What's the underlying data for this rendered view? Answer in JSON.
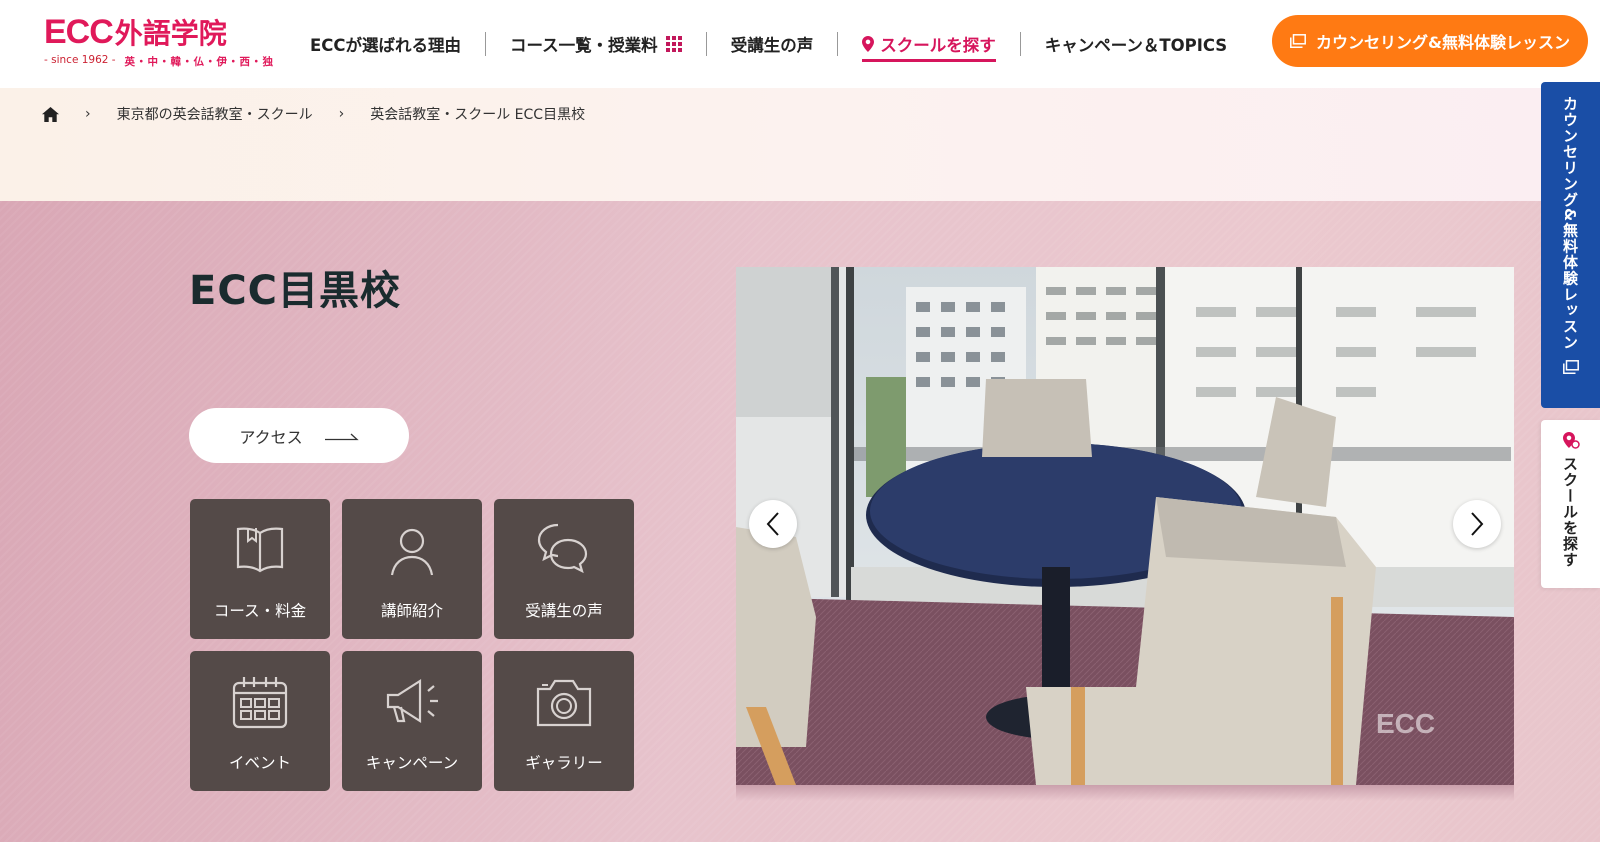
{
  "logo": {
    "brand": "ECC",
    "name_jp": "外語学院",
    "since": "- since 1962 -",
    "languages": "英・中・韓・仏・伊・西・独"
  },
  "nav": {
    "items": [
      {
        "label": "ECCが選ばれる理由"
      },
      {
        "label": "コース一覧・授業料"
      },
      {
        "label": "受講生の声"
      },
      {
        "label": "スクールを探す",
        "active": true
      },
      {
        "label": "キャンペーン＆TOPICS"
      }
    ],
    "cta_label": "カウンセリング&無料体験レッスン"
  },
  "breadcrumb": {
    "items": [
      "東京都の英会話教室・スクール",
      "英会話教室・スクール ECC目黒校"
    ]
  },
  "school": {
    "title": "ECC目黒校",
    "access_label": "アクセス"
  },
  "tiles": [
    {
      "label": "コース・料金",
      "icon": "book-icon"
    },
    {
      "label": "講師紹介",
      "icon": "person-icon"
    },
    {
      "label": "受講生の声",
      "icon": "speech-bubbles-icon"
    },
    {
      "label": "イベント",
      "icon": "calendar-icon"
    },
    {
      "label": "キャンペーン",
      "icon": "megaphone-icon"
    },
    {
      "label": "ギャラリー",
      "icon": "camera-icon"
    }
  ],
  "photo": {
    "watermark": "ECC"
  },
  "side_tabs": {
    "counseling_label": "カウンセリング&無料体験レッスン",
    "find_school_label": "スクールを探す"
  },
  "colors": {
    "brand_pink": "#e0195a",
    "cta_orange": "#ff7a13",
    "side_blue": "#1a4ea6",
    "tile_bg": "#544a48"
  }
}
